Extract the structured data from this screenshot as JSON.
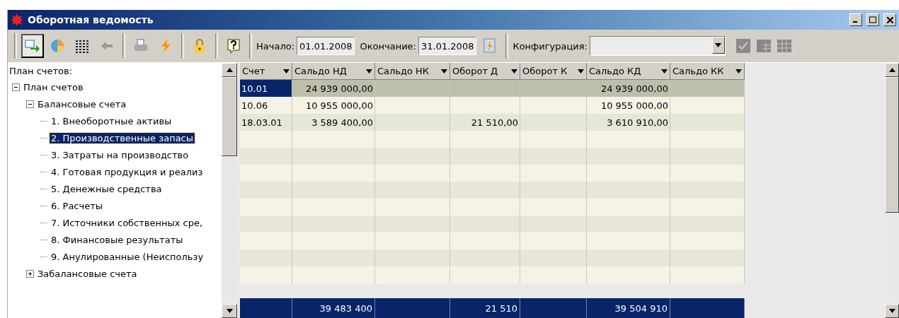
{
  "window": {
    "title": "Оборотная ведомость"
  },
  "toolbar": {
    "buttons": [
      {
        "selected": true
      },
      {
        "selected": false
      },
      {
        "selected": false
      },
      {
        "selected": false
      },
      {
        "selected": false
      },
      {
        "selected": false
      },
      {
        "selected": false
      },
      {
        "selected": false
      }
    ],
    "start_label": "Начало:",
    "start_value": "01.01.2008",
    "end_label": "Окончание:",
    "end_value": "31.01.2008",
    "config_label": "Конфигурация:"
  },
  "tree": {
    "title": "План счетов:",
    "items": [
      {
        "label": "План счетов",
        "expanded": true,
        "selected": false,
        "children": [
          {
            "label": "Балансовые счета",
            "expanded": true,
            "selected": false,
            "children": [
              {
                "label": "1. Внеоборотные активы",
                "selected": false
              },
              {
                "label": "2. Производственные запасы",
                "selected": true
              },
              {
                "label": "3. Затраты на производство",
                "selected": false
              },
              {
                "label": "4. Готовая продукция и реализ",
                "selected": false
              },
              {
                "label": "5. Денежные средства",
                "selected": false
              },
              {
                "label": "6. Расчеты",
                "selected": false
              },
              {
                "label": "7. Источники собственных сре,",
                "selected": false
              },
              {
                "label": "8. Финансовые результаты",
                "selected": false
              },
              {
                "label": "9. Анулированные (Неиспользу",
                "selected": false
              }
            ]
          },
          {
            "label": "Забалансовые счета",
            "expanded": false,
            "selected": false
          }
        ]
      }
    ]
  },
  "table": {
    "columns": [
      "Счет",
      "Сальдо НД",
      "Сальдо НК",
      "Оборот Д",
      "Оборот К",
      "Сальдо КД",
      "Сальдо КК"
    ],
    "rows": [
      {
        "selected": true,
        "cells": {
          "column_1": "10.01",
          "column_2": "24 939 000,00",
          "column_6": "24 939 000,00"
        }
      },
      {
        "selected": false,
        "cells": {
          "column_1": "10.06",
          "column_2": "10 955 000,00",
          "column_6": "10 955 000,00"
        }
      },
      {
        "selected": false,
        "cells": {
          "column_1": "18.03.01",
          "column_2": "3 589 400,00",
          "column_4": "21 510,00",
          "column_6": "3 610 910,00"
        }
      }
    ],
    "totals": {
      "column_2": "39 483 400",
      "column_4": "21 510",
      "column_6": "39 504 910"
    }
  }
}
